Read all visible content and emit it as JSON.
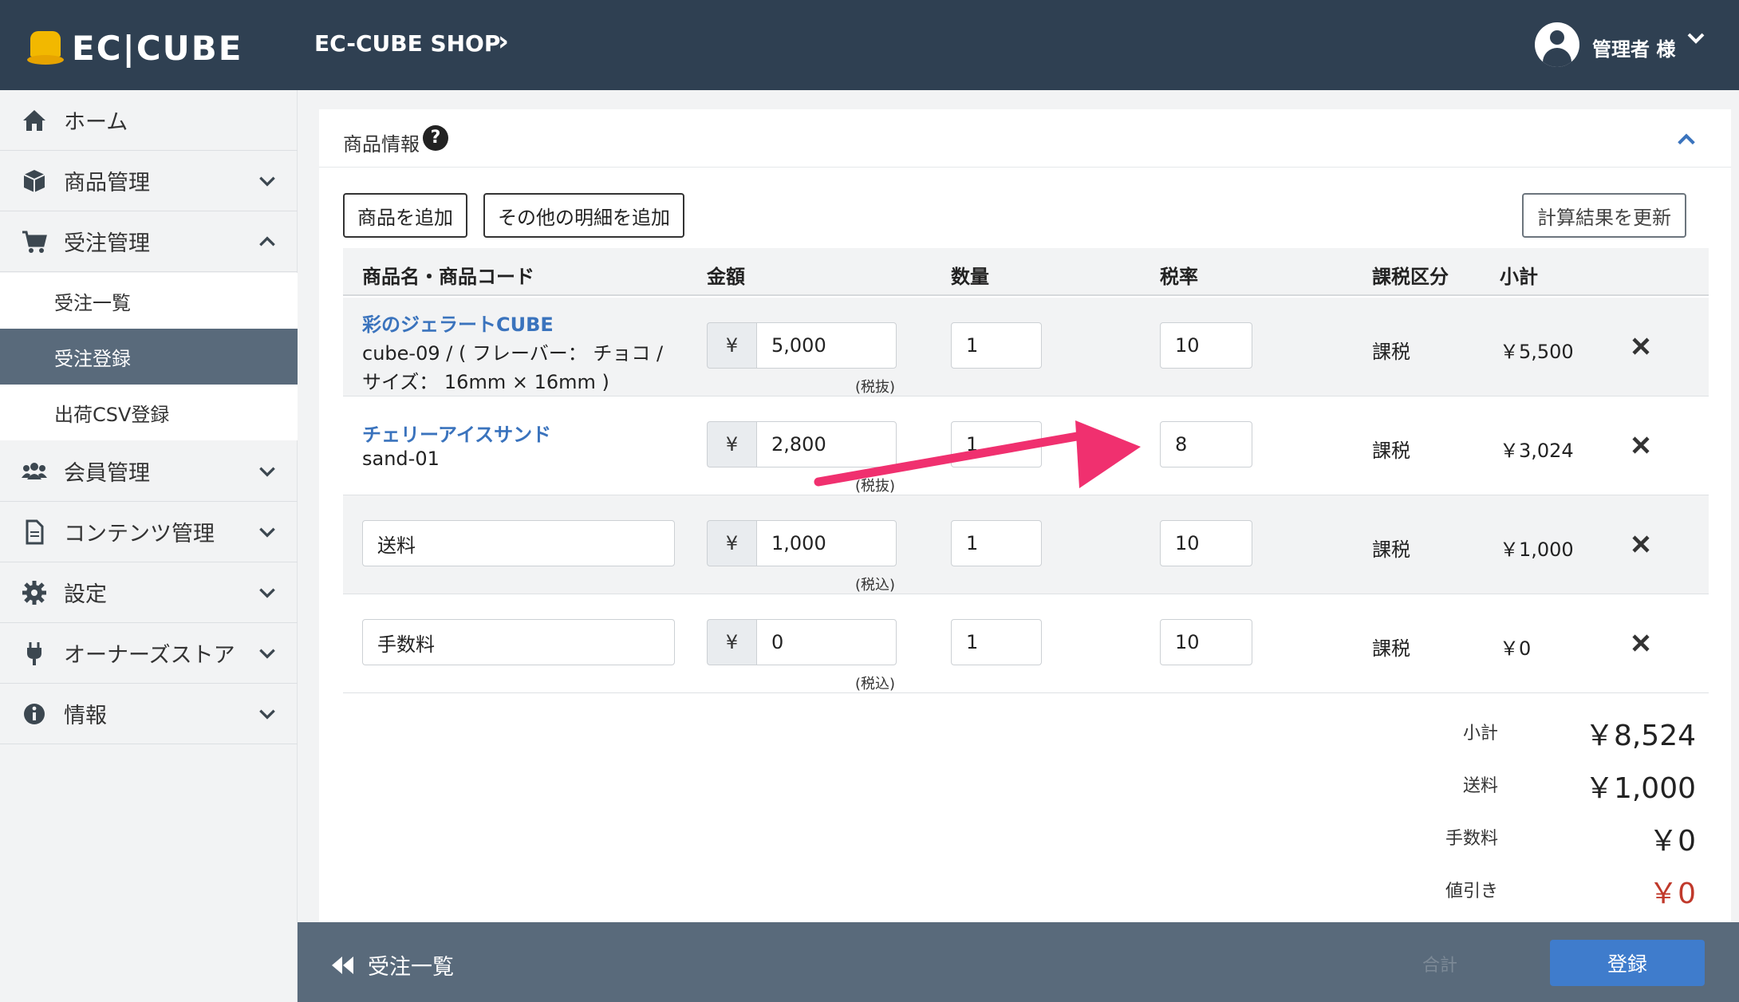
{
  "header": {
    "logo_text": "EC|CUBE",
    "shop_name": "EC-CUBE SHOP",
    "user_name": "管理者 様"
  },
  "sidebar": {
    "items": [
      {
        "label": "ホーム",
        "icon": "home-icon"
      },
      {
        "label": "商品管理",
        "icon": "cube-icon"
      },
      {
        "label": "受注管理",
        "icon": "cart-icon"
      },
      {
        "label": "会員管理",
        "icon": "users-icon"
      },
      {
        "label": "コンテンツ管理",
        "icon": "file-icon"
      },
      {
        "label": "設定",
        "icon": "gear-icon"
      },
      {
        "label": "オーナーズストア",
        "icon": "plug-icon"
      },
      {
        "label": "情報",
        "icon": "info-icon"
      }
    ],
    "sub_items": [
      {
        "label": "受注一覧"
      },
      {
        "label": "受注登録"
      },
      {
        "label": "出荷CSV登録"
      }
    ]
  },
  "card": {
    "title": "商品情報",
    "add_product_label": "商品を追加",
    "add_other_label": "その他の明細を追加",
    "update_label": "計算結果を更新",
    "columns": [
      "商品名・商品コード",
      "金額",
      "数量",
      "税率",
      "課税区分",
      "小計"
    ],
    "rows": [
      {
        "name": "彩のジェラートCUBE",
        "code_line1": "cube-09 / ( フレーバー： チョコ /",
        "code_line2": "サイズ： 16mm × 16mm )",
        "currency": "¥",
        "price": "5,000",
        "tax_note": "(税抜)",
        "qty": "1",
        "rate": "10",
        "tax_type": "課税",
        "subtotal": "￥5,500"
      },
      {
        "name": "チェリーアイスサンド",
        "code_line1": "sand-01",
        "currency": "¥",
        "price": "2,800",
        "tax_note": "(税抜)",
        "qty": "1",
        "rate": "8",
        "tax_type": "課税",
        "subtotal": "￥3,024"
      },
      {
        "name": "送料",
        "currency": "¥",
        "price": "1,000",
        "tax_note": "(税込)",
        "qty": "1",
        "rate": "10",
        "tax_type": "課税",
        "subtotal": "￥1,000"
      },
      {
        "name": "手数料",
        "currency": "¥",
        "price": "0",
        "tax_note": "(税込)",
        "qty": "1",
        "rate": "10",
        "tax_type": "課税",
        "subtotal": "￥0"
      }
    ],
    "totals": [
      {
        "label": "小計",
        "value": "￥8,524"
      },
      {
        "label": "送料",
        "value": "￥1,000"
      },
      {
        "label": "手数料",
        "value": "￥0"
      },
      {
        "label": "値引き",
        "value": "￥0"
      }
    ],
    "discount_color": "#c0392b"
  },
  "footer": {
    "back_label": "受注一覧",
    "total_label": "合計",
    "register_label": "登録"
  },
  "annotation": {
    "arrow_color": "#f0306f"
  }
}
